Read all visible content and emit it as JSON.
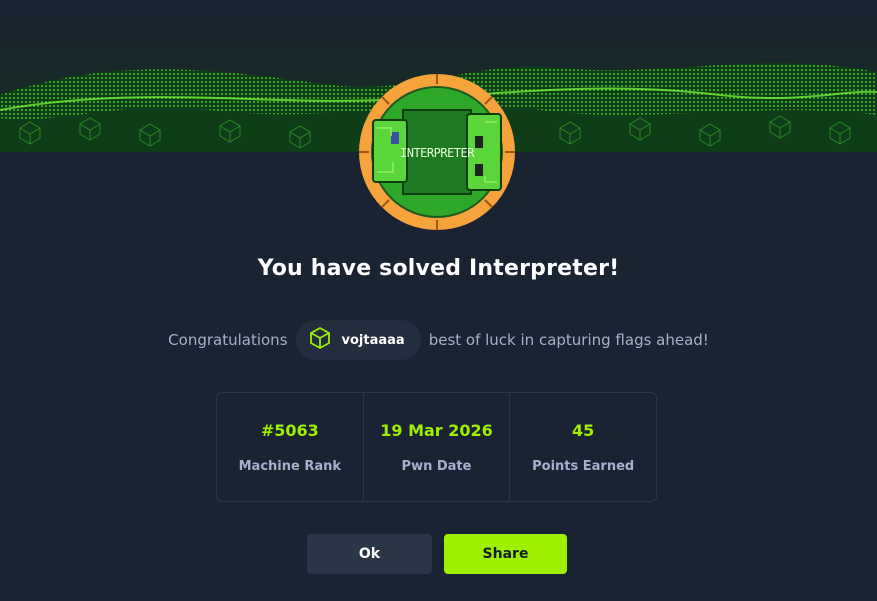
{
  "banner": {
    "image": "green-cube-wave-banner",
    "accent": "#9fef00"
  },
  "badge": {
    "image": "interpreter-machine-badge",
    "label": "INTERPRETER",
    "ring_color": "#f7a33c"
  },
  "modal": {
    "title": "You have solved Interpreter!",
    "congrats_prefix": "Congratulations",
    "username": "vojtaaaa",
    "user_icon": "hackthebox-cube-icon",
    "congrats_suffix": "best of luck in capturing flags ahead!"
  },
  "stats": [
    {
      "value": "#5063",
      "label": "Machine Rank"
    },
    {
      "value": "19 Mar 2026",
      "label": "Pwn Date"
    },
    {
      "value": "45",
      "label": "Points Earned"
    }
  ],
  "buttons": {
    "ok": "Ok",
    "share": "Share"
  },
  "colors": {
    "background": "#1a2332",
    "accent": "#9fef00",
    "muted": "#a4b1cd"
  }
}
